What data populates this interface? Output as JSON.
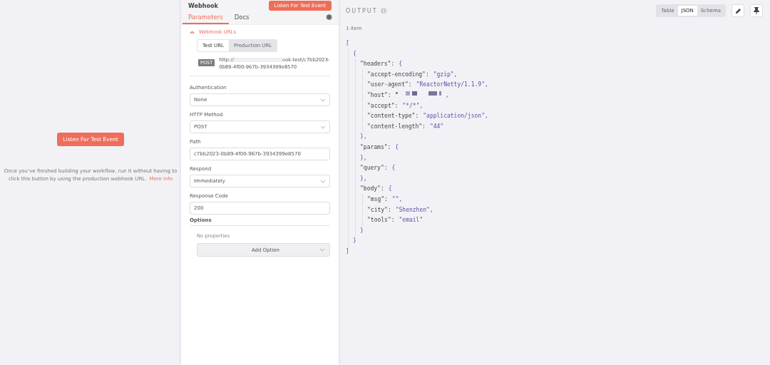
{
  "canvas": {
    "listen_button": "Listen For Test Event",
    "hint": "Once you’ve finished building your workflow, run it without having to click this button by using the production webhook URL.",
    "more_info": "More info"
  },
  "panel": {
    "title": "Webhook",
    "listen_button": "Listen For Test Event",
    "tabs": [
      {
        "label": "Parameters",
        "selected": true
      },
      {
        "label": "Docs",
        "selected": false
      }
    ],
    "webhook_urls": {
      "title": "Webhook URLs",
      "expanded": true,
      "url_tabs": [
        {
          "label": "Test URL",
          "selected": true
        },
        {
          "label": "Production URL",
          "selected": false
        }
      ],
      "method": "POST",
      "url_start": "http://",
      "url_end": "ook-test/c7bb2023-0b89-4f00-967b-3934399e8570"
    },
    "fields": [
      {
        "label": "Authentication",
        "kind": "select",
        "value": "None"
      },
      {
        "label": "HTTP Method",
        "kind": "select",
        "value": "POST"
      },
      {
        "label": "Path",
        "kind": "input",
        "value": "c7bb2023-0b89-4f00-967b-3934399e8570"
      },
      {
        "label": "Respond",
        "kind": "select",
        "value": "Immediately"
      },
      {
        "label": "Response Code",
        "kind": "input",
        "value": "200"
      }
    ],
    "options": {
      "title": "Options",
      "empty": "No properties",
      "add_button": "Add Option"
    }
  },
  "output": {
    "title": "OUTPUT",
    "views": [
      {
        "label": "Table",
        "selected": false
      },
      {
        "label": "JSON",
        "selected": true
      },
      {
        "label": "Schema",
        "selected": false
      }
    ],
    "count": "1 item",
    "tree": {
      "open": "[",
      "close": "]",
      "children": [
        {
          "open": "{",
          "close": "}",
          "children": [
            {
              "key": "\"headers\":",
              "open": "{",
              "close": "},",
              "children": [
                {
                  "key": "\"accept-encoding\":",
                  "value": "\"gzip\","
                },
                {
                  "key": "\"user-agent\":",
                  "value": "\"ReactorNetty/1.1.9\","
                },
                {
                  "key": "\"host\":",
                  "redacted": true,
                  "value": ","
                },
                {
                  "key": "\"accept\":",
                  "value": "\"*/*\","
                },
                {
                  "key": "\"content-type\":",
                  "value": "\"application/json\","
                },
                {
                  "key": "\"content-length\":",
                  "value": "\"44\""
                }
              ]
            },
            {
              "key": "\"params\":",
              "open": "{",
              "close": "},"
            },
            {
              "key": "\"query\":",
              "open": "{",
              "close": "},"
            },
            {
              "key": "\"body\":",
              "open": "{",
              "close": "}",
              "children": [
                {
                  "key": "\"msg\":",
                  "value": "\"\","
                },
                {
                  "key": "\"city\":",
                  "value": "\"Shenzhen\","
                },
                {
                  "key": "\"tools\":",
                  "value": "\"email\""
                }
              ]
            }
          ]
        }
      ]
    }
  }
}
